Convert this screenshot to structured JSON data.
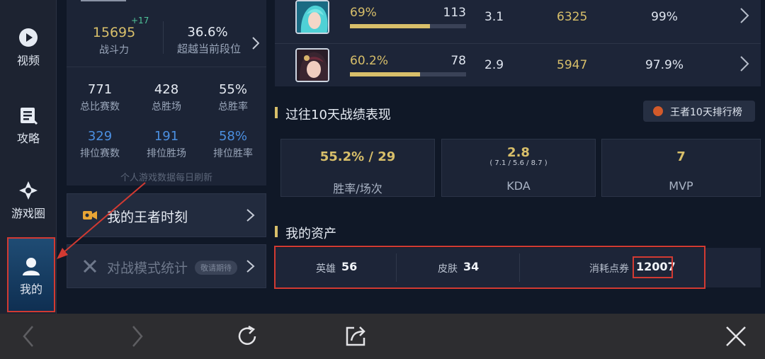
{
  "sidebar": {
    "items": [
      {
        "label": "视频",
        "icon": "play-circle-icon"
      },
      {
        "label": "攻略",
        "icon": "guide-icon"
      },
      {
        "label": "游戏圈",
        "icon": "community-icon"
      },
      {
        "label": "我的",
        "icon": "user-icon",
        "selected": true
      }
    ]
  },
  "profile": {
    "power": {
      "value": "15695",
      "delta": "+17",
      "label": "战斗力"
    },
    "surpass": {
      "value": "36.6%",
      "label": "超越当前段位"
    },
    "stats": [
      {
        "value": "771",
        "label": "总比赛数"
      },
      {
        "value": "428",
        "label": "总胜场"
      },
      {
        "value": "55%",
        "label": "总胜率"
      },
      {
        "value": "329",
        "label": "排位赛数"
      },
      {
        "value": "191",
        "label": "排位胜场"
      },
      {
        "value": "58%",
        "label": "排位胜率"
      }
    ],
    "refresh_note": "个人游戏数据每日刷新"
  },
  "menu": {
    "moments": "我的王者时刻",
    "battle_stats": "对战模式统计",
    "coming_soon": "敬请期待"
  },
  "heroes": [
    {
      "win_rate": "69%",
      "win_rate_value": 0.69,
      "games": "113",
      "kda": "3.1",
      "score": "6325",
      "percent": "99%",
      "avatar": "hero-avatar-teal-hair"
    },
    {
      "win_rate": "60.2%",
      "win_rate_value": 0.602,
      "games": "78",
      "kda": "2.9",
      "score": "5947",
      "percent": "97.9%",
      "avatar": "hero-avatar-dark-hair"
    }
  ],
  "recent": {
    "title": "过往10天战绩表现",
    "rank_button": "王者10天排行榜",
    "boxes": [
      {
        "main": "55.2% / 29",
        "sub": "",
        "label": "胜率/场次"
      },
      {
        "main": "2.8",
        "sub": "( 7.1 / 5.6 / 8.7 )",
        "label": "KDA"
      },
      {
        "main": "7",
        "sub": "",
        "label": "MVP"
      }
    ]
  },
  "assets": {
    "title": "我的资产",
    "hero_label": "英雄",
    "hero_value": "56",
    "skin_label": "皮肤",
    "skin_value": "34",
    "coupon_label": "消耗点券",
    "coupon_value": "12007"
  },
  "toolbar": {
    "icons": [
      "back-arrow-icon",
      "forward-arrow-icon",
      "refresh-icon",
      "share-icon",
      "close-icon"
    ]
  },
  "colors": {
    "accent_gold": "#d8bf6a",
    "accent_blue": "#4b8fe0",
    "annotation_red": "#d23a32"
  }
}
